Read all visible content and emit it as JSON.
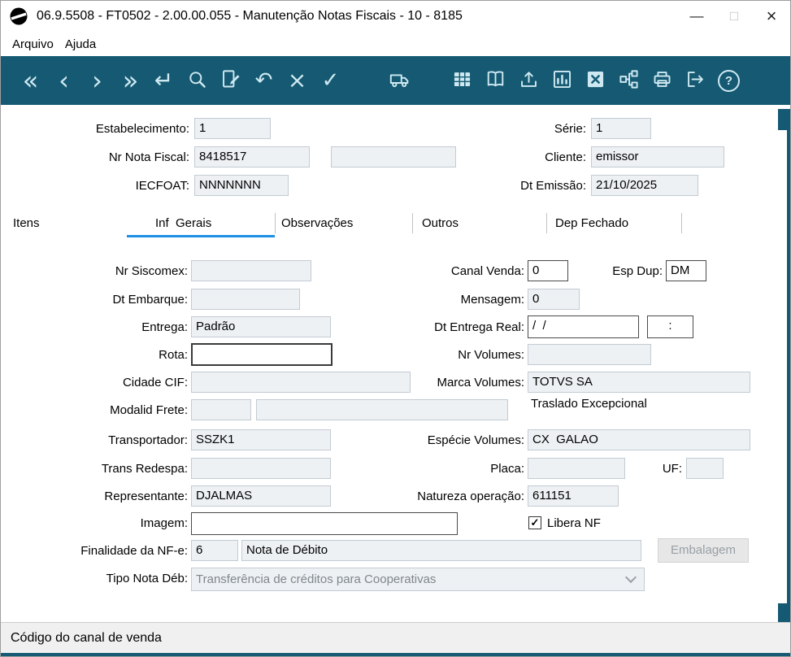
{
  "window": {
    "title": "06.9.5508 - FT0502 - 2.00.00.055 - Manutenção Notas Fiscais - 10 - 8185",
    "minimize_glyph": "—",
    "maximize_glyph": "□",
    "close_glyph": "×"
  },
  "menubar": {
    "arquivo": "Arquivo",
    "ajuda": "Ajuda"
  },
  "toolbar": {
    "background_color": "#155a72",
    "icon_color": "#cfe9f2",
    "glyphs": {
      "first": "«",
      "previous": "‹",
      "next": "›",
      "last": "»",
      "enter": "↵",
      "undo": "↶",
      "cancel": "×",
      "confirm": "✓",
      "help": "?"
    }
  },
  "header": {
    "estabelecimento": {
      "label": "Estabelecimento:",
      "value": "1"
    },
    "serie": {
      "label": "Série:",
      "value": "1"
    },
    "nr_nota_fiscal": {
      "label": "Nr Nota Fiscal:",
      "value": "8418517",
      "value2": ""
    },
    "cliente": {
      "label": "Cliente:",
      "value": "emissor"
    },
    "iecfoat": {
      "label": "IECFOAT:",
      "value": "NNNNNNN"
    },
    "dt_emissao": {
      "label": "Dt Emissão:",
      "value": "21/10/2025"
    }
  },
  "tabs": {
    "underline_color": "#1f8fe5",
    "items": [
      {
        "label": "Itens",
        "active": false
      },
      {
        "label": "Inf  Gerais",
        "active": true
      },
      {
        "label": "Observações",
        "active": false
      },
      {
        "label": "Outros",
        "active": false
      },
      {
        "label": "Dep Fechado",
        "active": false
      }
    ]
  },
  "form": {
    "nr_siscomex": {
      "label": "Nr Siscomex:",
      "value": ""
    },
    "canal_venda": {
      "label": "Canal Venda:",
      "value": "0"
    },
    "esp_dup": {
      "label": "Esp Dup:",
      "value": "DM"
    },
    "dt_embarque": {
      "label": "Dt Embarque:",
      "value": ""
    },
    "mensagem": {
      "label": "Mensagem:",
      "value": "0"
    },
    "entrega": {
      "label": "Entrega:",
      "value": "Padrão"
    },
    "dt_entrega_real": {
      "label": "Dt Entrega Real:",
      "date_value": "/  /",
      "time_value": ":"
    },
    "rota": {
      "label": "Rota:",
      "value": ""
    },
    "nr_volumes": {
      "label": "Nr Volumes:",
      "value": ""
    },
    "cidade_cif": {
      "label": "Cidade CIF:",
      "value": ""
    },
    "marca_volumes": {
      "label": "Marca Volumes:",
      "value": "TOTVS SA"
    },
    "traslado_excepcional": "Traslado Excepcional",
    "modalid_frete": {
      "label": "Modalid Frete:",
      "value1": "",
      "value2": ""
    },
    "transportador": {
      "label": "Transportador:",
      "value": "SSZK1"
    },
    "especie_volumes": {
      "label": "Espécie Volumes:",
      "value": "CX  GALAO"
    },
    "trans_redespa": {
      "label": "Trans Redespa:",
      "value": ""
    },
    "placa": {
      "label": "Placa:",
      "value": ""
    },
    "uf": {
      "label": "UF:",
      "value": ""
    },
    "representante": {
      "label": "Representante:",
      "value": "DJALMAS"
    },
    "natureza_operacao": {
      "label": "Natureza operação:",
      "value": "611151"
    },
    "imagem": {
      "label": "Imagem:",
      "value": ""
    },
    "libera_nf": {
      "label": "Libera NF",
      "checked": true,
      "check_glyph": "✓"
    },
    "finalidade_nfe": {
      "label": "Finalidade da NF-e:",
      "code": "6",
      "description": "Nota de Débito"
    },
    "embalagem_button": {
      "label": "Embalagem"
    },
    "tipo_nota_deb": {
      "label": "Tipo Nota Déb:",
      "value": "Transferência de créditos para Cooperativas"
    }
  },
  "statusbar": {
    "text": "Código do canal de venda"
  }
}
